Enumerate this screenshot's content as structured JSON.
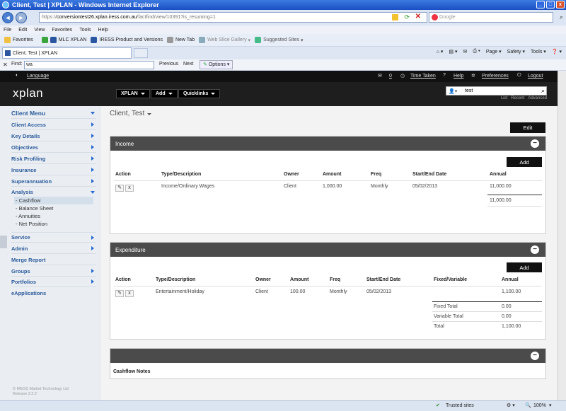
{
  "window": {
    "title": "Client, Test | XPLAN - Windows Internet Explorer"
  },
  "address": {
    "url_prefix": "https://",
    "url_domain": "conversiontest26.xplan.iress.com.au",
    "url_path": "/factfind/view/10391?is_resuming=1",
    "search_placeholder": "Google"
  },
  "menubar": [
    "File",
    "Edit",
    "View",
    "Favorites",
    "Tools",
    "Help"
  ],
  "favorites": {
    "label": "Favorites",
    "items": [
      "MLC XPLAN",
      "IRESS Product and Versions",
      "New Tab",
      "Web Slice Gallery",
      "Suggested Sites"
    ]
  },
  "tab": {
    "label": "Client, Test | XPLAN"
  },
  "commands": [
    "Page",
    "Safety",
    "Tools"
  ],
  "find": {
    "label": "Find:",
    "value": "wa",
    "previous": "Previous",
    "next": "Next",
    "options": "Options"
  },
  "appbar": {
    "language": "Language",
    "mail_count": "0",
    "time_taken": "Time Taken",
    "help": "Help",
    "preferences": "Preferences",
    "logout": "Logout"
  },
  "header": {
    "logo": "xplan",
    "menus": [
      "XPLAN",
      "Add",
      "Quicklinks"
    ],
    "search_value": "test",
    "search_links": [
      "List",
      "Recent",
      "Advanced"
    ]
  },
  "sidebar": {
    "title": "Client Menu",
    "items": [
      "Client Access",
      "Key Details",
      "Objectives",
      "Risk Profiling",
      "Insurance",
      "Superannuation",
      "Analysis"
    ],
    "analysis_sub": [
      "- Cashflow",
      "- Balance Sheet",
      "- Annuities",
      "- Net Position"
    ],
    "items2": [
      "Service",
      "Admin",
      "Merge Report",
      "Groups",
      "Portfolios",
      "eApplications"
    ],
    "copyright": [
      "© IRESS Market Technology Ltd",
      "Release 2.2.2"
    ]
  },
  "main": {
    "client_name": "Client, Test",
    "edit": "Edit",
    "income": {
      "title": "Income",
      "add": "Add",
      "headers": [
        "Action",
        "Type/Description",
        "Owner",
        "Amount",
        "Freq",
        "Start/End Date",
        "Annual"
      ],
      "row": {
        "type": "Income/Ordinary Wages",
        "owner": "Client",
        "amount": "1,000.00",
        "freq": "Monthly",
        "date": "05/02/2013",
        "annual": "11,000.00"
      },
      "total": "11,000.00"
    },
    "expenditure": {
      "title": "Expenditure",
      "add": "Add",
      "headers": [
        "Action",
        "Type/Description",
        "Owner",
        "Amount",
        "Freq",
        "Start/End Date",
        "Fixed/Variable",
        "Annual"
      ],
      "row": {
        "type": "Entertainment/Holiday",
        "owner": "Client",
        "amount": "100.00",
        "freq": "Monthly",
        "date": "05/02/2013",
        "annual": "1,100.00"
      },
      "fixed_total_label": "Fixed Total",
      "fixed_total": "0.00",
      "variable_total_label": "Variable Total",
      "variable_total": "0.00",
      "total_label": "Total",
      "total": "1,100.00"
    },
    "notes": {
      "title": "Cashflow Notes"
    }
  },
  "status": {
    "zone": "Trusted sites",
    "zoom": "100%"
  }
}
